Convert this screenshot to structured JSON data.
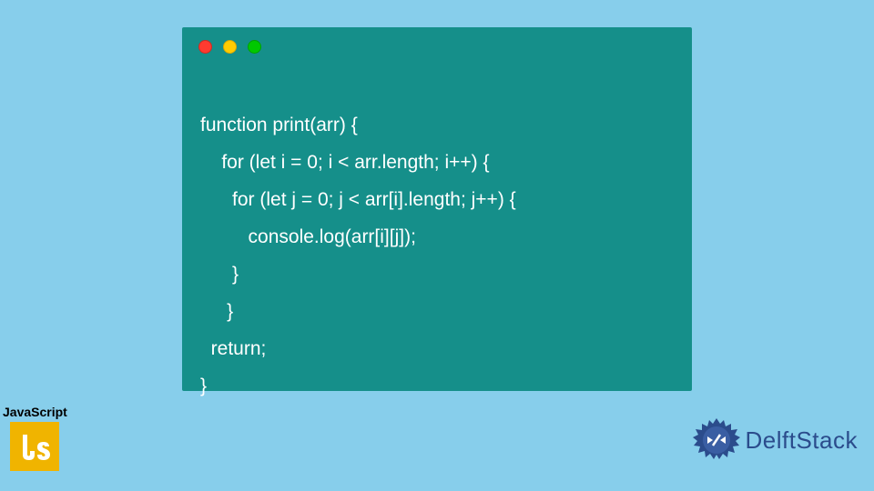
{
  "code": {
    "lines": [
      "function print(arr) {",
      "    for (let i = 0; i < arr.length; i++) {",
      "     for (let j = 0; j < arr[i].length; j++) {",
      "       console.log(arr[i][j]);",
      "     }",
      "    }",
      "  return;",
      "}"
    ]
  },
  "badges": {
    "js_label": "JavaScript",
    "js_icon_name": "javascript-shield-icon"
  },
  "brand": {
    "name": "DelftStack",
    "logo_name": "delftstack-logo-icon"
  },
  "colors": {
    "background": "#87ceeb",
    "window": "#158f8a",
    "text": "#ffffff",
    "js_yellow": "#f0b400",
    "delft_blue": "#2b4c8c"
  }
}
